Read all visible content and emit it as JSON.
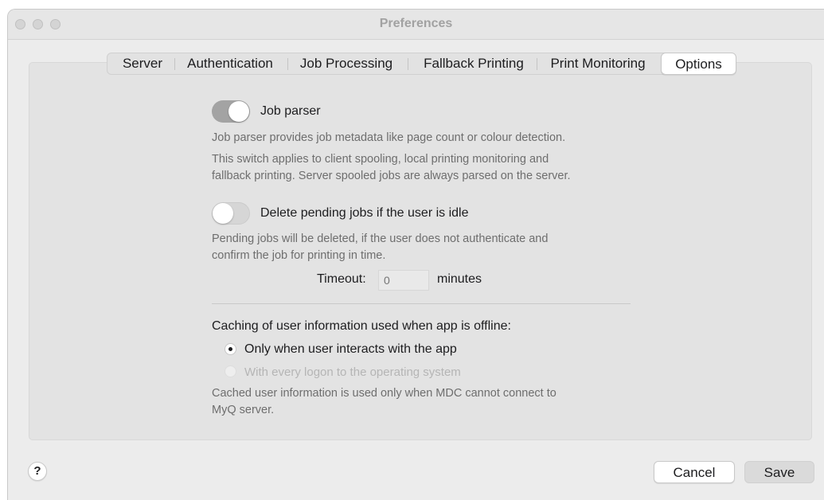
{
  "window": {
    "title": "Preferences"
  },
  "tabs": [
    {
      "label": "Server",
      "selected": false
    },
    {
      "label": "Authentication",
      "selected": false
    },
    {
      "label": "Job Processing",
      "selected": false
    },
    {
      "label": "Fallback Printing",
      "selected": false
    },
    {
      "label": "Print Monitoring",
      "selected": false
    },
    {
      "label": "Options",
      "selected": true
    }
  ],
  "job_parser": {
    "label": "Job parser",
    "enabled": true,
    "desc_1": "Job parser provides job metadata like page count or colour detection.",
    "desc_2_line1": "This switch applies to client spooling, local printing monitoring and",
    "desc_2_line2": "fallback printing. Server spooled jobs are always parsed on the server."
  },
  "delete_pending": {
    "label": "Delete pending jobs if the user is idle",
    "enabled": false,
    "desc_line1": "Pending jobs will be deleted, if the user does not authenticate and",
    "desc_line2": "confirm the job for printing in time.",
    "timeout_label": "Timeout:",
    "timeout_placeholder": "0",
    "timeout_unit": "minutes"
  },
  "caching": {
    "heading": "Caching of user information used when app is offline:",
    "options": [
      {
        "label": "Only when user interacts with the app",
        "checked": true,
        "disabled": false
      },
      {
        "label": "With every logon to the operating system",
        "checked": false,
        "disabled": true
      }
    ],
    "note_line1": "Cached user information is used only when MDC cannot connect to",
    "note_line2": "MyQ server."
  },
  "footer": {
    "help_label": "?",
    "cancel_label": "Cancel",
    "save_label": "Save"
  },
  "colors": {
    "window_bg": "#ececec",
    "panel_bg": "#e3e3e3",
    "toggle_on": "#a3a3a3",
    "toggle_off": "#d6d6d6",
    "muted_text": "#6e6e6e"
  }
}
